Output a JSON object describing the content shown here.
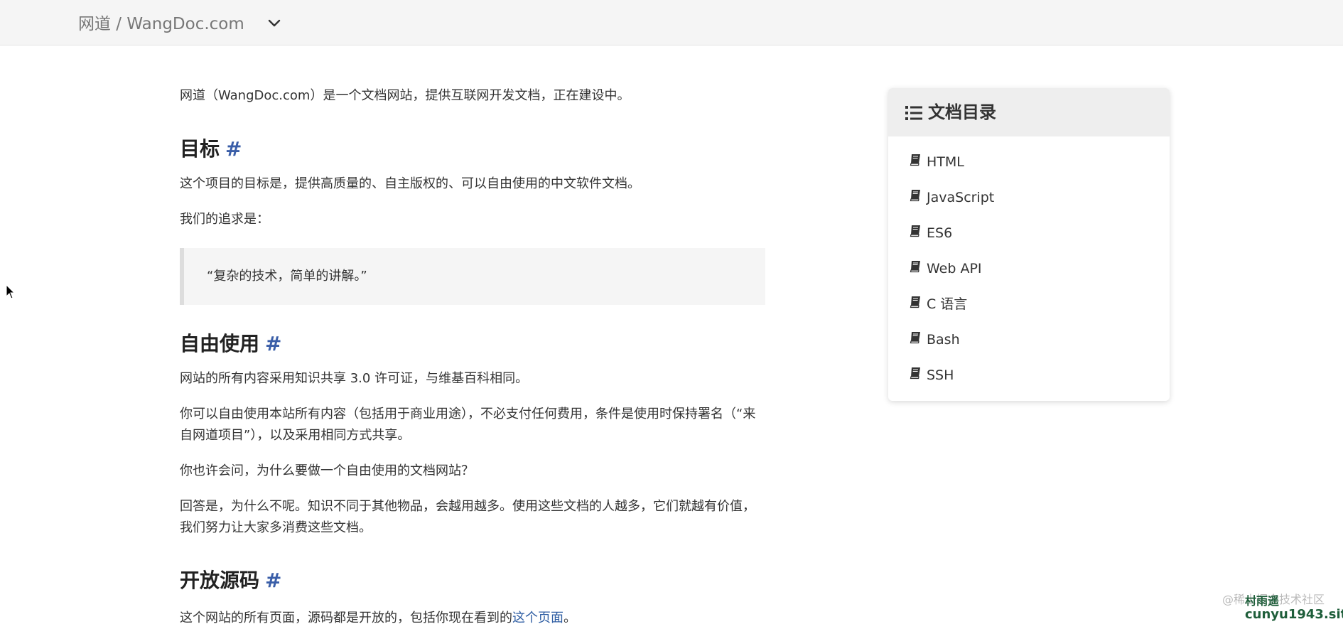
{
  "header": {
    "brand": "网道 / WangDoc.com",
    "dropdown_icon": "chevron-down-icon"
  },
  "content": {
    "intro": "网道（WangDoc.com）是一个文档网站，提供互联网开发文档，正在建设中。",
    "sections": [
      {
        "heading": "目标",
        "anchor": "#",
        "paragraphs": [
          "这个项目的目标是，提供高质量的、自主版权的、可以自由使用的中文软件文档。",
          "我们的追求是："
        ],
        "quote": "“复杂的技术，简单的讲解。”"
      },
      {
        "heading": "自由使用",
        "anchor": "#",
        "paragraphs": [
          "网站的所有内容采用知识共享 3.0 许可证，与维基百科相同。",
          "你可以自由使用本站所有内容（包括用于商业用途），不必支付任何费用，条件是使用时保持署名（“来自网道项目”），以及采用相同方式共享。",
          "你也许会问，为什么要做一个自由使用的文档网站？",
          "回答是，为什么不呢。知识不同于其他物品，会越用越多。使用这些文档的人越多，它们就越有价值，我们努力让大家多消费这些文档。"
        ]
      },
      {
        "heading": "开放源码",
        "anchor": "#",
        "paragraph_prefix": "这个网站的所有页面，源码都是开放的，包括你现在看到的",
        "link_text": "这个页面",
        "paragraph_suffix": "。"
      }
    ]
  },
  "toc": {
    "title": "文档目录",
    "title_icon": "list-icon",
    "items": [
      {
        "label": "HTML",
        "icon": "book-icon"
      },
      {
        "label": "JavaScript",
        "icon": "book-icon"
      },
      {
        "label": "ES6",
        "icon": "book-icon"
      },
      {
        "label": "Web API",
        "icon": "book-icon"
      },
      {
        "label": "C 语言",
        "icon": "book-icon"
      },
      {
        "label": "Bash",
        "icon": "book-icon"
      },
      {
        "label": "SSH",
        "icon": "book-icon"
      }
    ]
  },
  "watermark": {
    "faded": "@稀土掘金技术社区",
    "line1": "村雨遥",
    "line2": "cunyu1943.site"
  },
  "colors": {
    "accent": "#3a5ea8",
    "link": "#2f5ea3",
    "topbar_bg": "#f5f5f5",
    "quote_bg": "#f5f5f5",
    "toc_header_bg": "#eeeeee"
  }
}
